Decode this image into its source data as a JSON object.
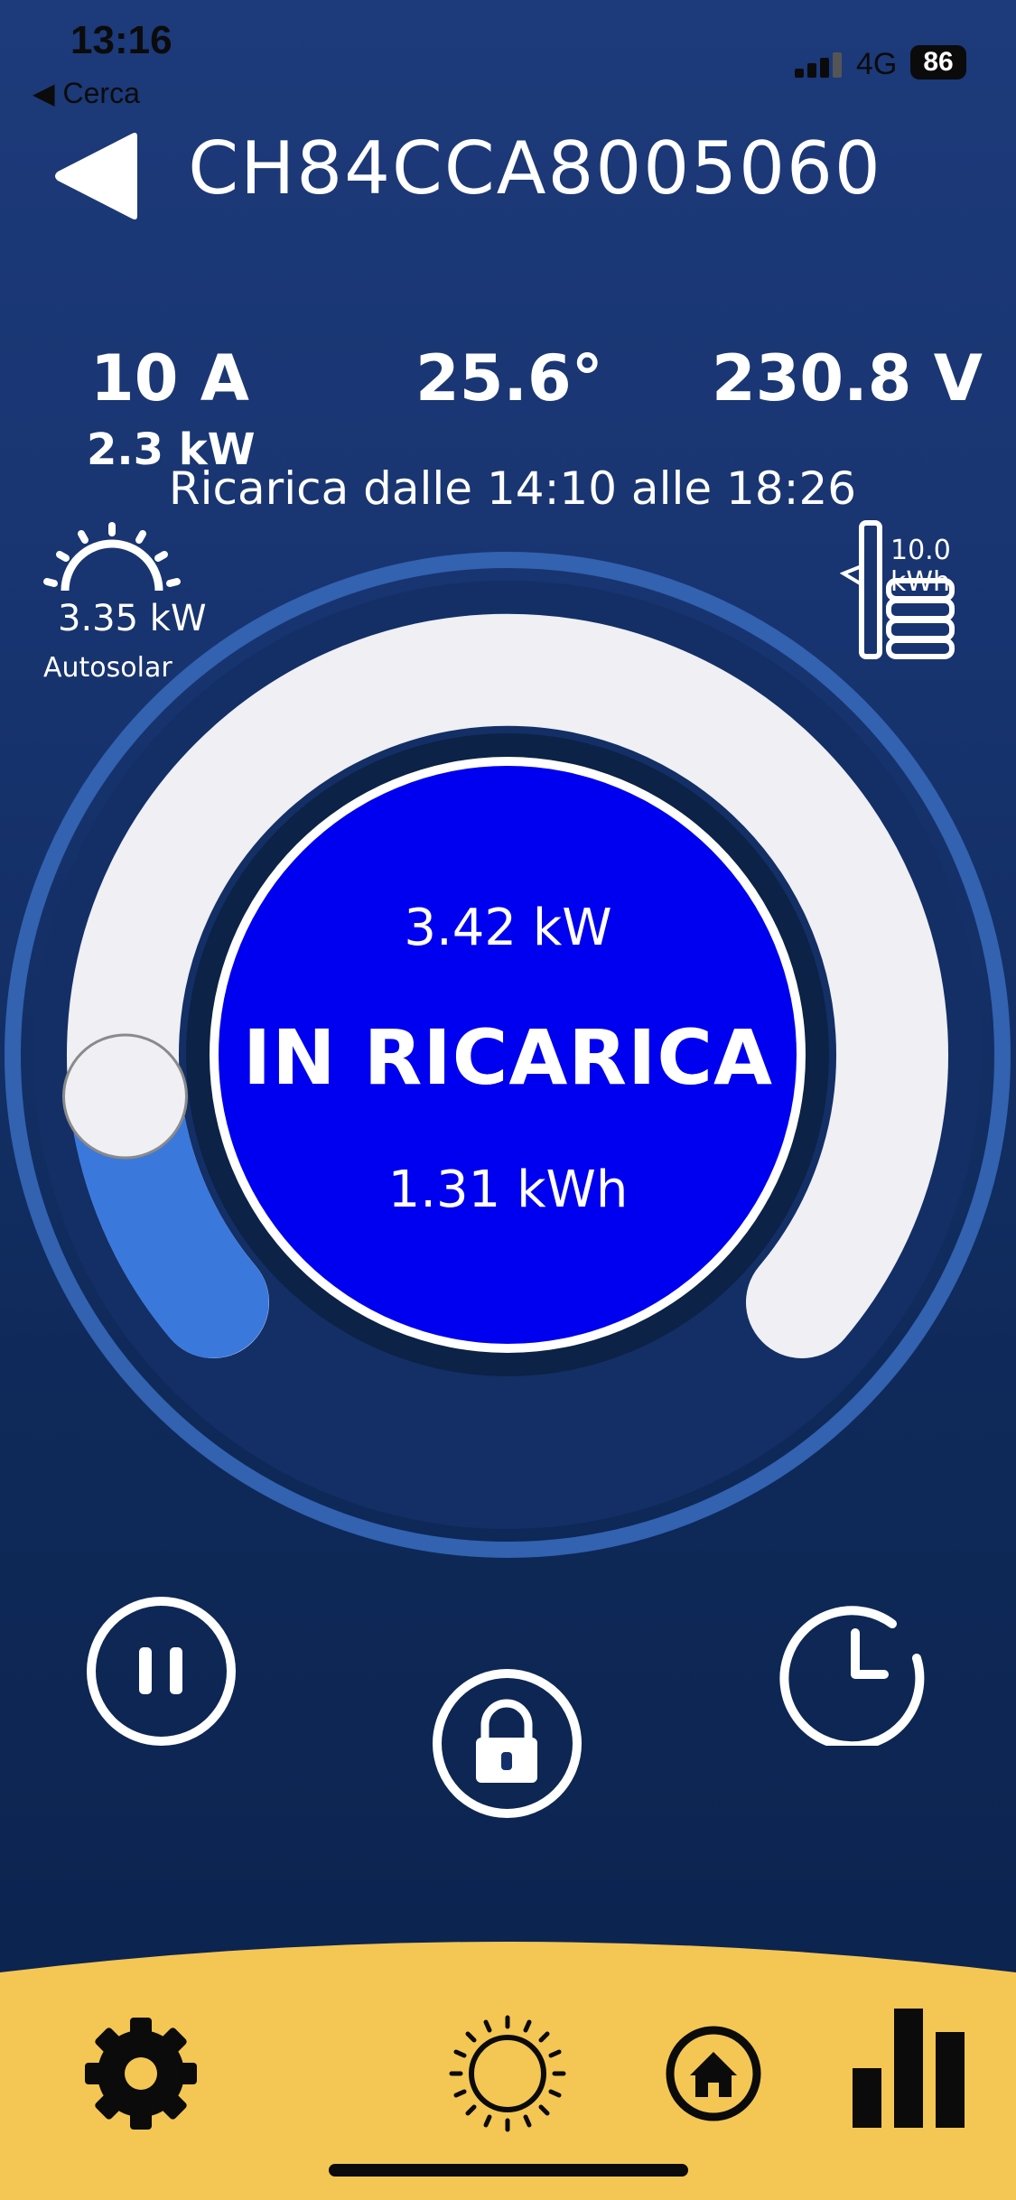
{
  "status_bar": {
    "time": "13:16",
    "back_app": "◀ Cerca",
    "network": "4G",
    "battery": "86"
  },
  "header": {
    "title": "CH84CCA8005060"
  },
  "metrics": {
    "current": "10 A",
    "power_limit": "2.3 kW",
    "temperature": "25.6°",
    "voltage": "230.8 V"
  },
  "schedule": "Ricarica dalle 14:10 alle 18:26",
  "solar": {
    "power": "3.35 kW",
    "label": "Autosolar"
  },
  "battery_storage": {
    "capacity": "10.0 kWh"
  },
  "charger": {
    "power": "3.42 kW",
    "state": "IN RICARICA",
    "energy": "1.31 kWh",
    "slider_level": 0.13
  },
  "colors": {
    "background": "#183470",
    "gauge_track": "#efeff4",
    "gauge_fill": "#3a78dc",
    "center_disc": "#0000f0",
    "bottom_bar": "#f4c653"
  },
  "controls": {
    "pause": "pause-icon",
    "lock": "lock-icon",
    "schedule": "clock-icon"
  },
  "bottom_nav": [
    "gear-icon",
    "sun-icon",
    "home-icon",
    "bar-chart-icon"
  ]
}
